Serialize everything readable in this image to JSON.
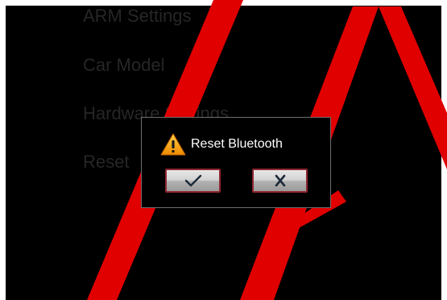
{
  "menu": {
    "items": [
      {
        "label": "ARM Settings"
      },
      {
        "label": "Car Model"
      },
      {
        "label": "Hardware Settings"
      },
      {
        "label": "Reset"
      }
    ]
  },
  "dialog": {
    "title": "Reset Bluetooth",
    "icon": "warning-icon",
    "confirm_icon": "checkmark-icon",
    "cancel_icon": "close-icon"
  },
  "colors": {
    "screen_background": "#000000",
    "menu_text": "#262626",
    "dialog_border": "#6e6e6e",
    "button_border": "#8e2630",
    "warning": "#f5a100",
    "watermark": "#e00000"
  }
}
